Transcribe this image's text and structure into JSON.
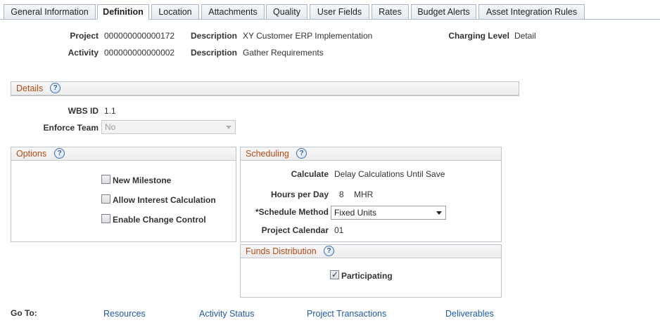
{
  "tabs": [
    {
      "label": "General Information"
    },
    {
      "label": "Definition",
      "active": true
    },
    {
      "label": "Location"
    },
    {
      "label": "Attachments"
    },
    {
      "label": "Quality"
    },
    {
      "label": "User Fields"
    },
    {
      "label": "Rates"
    },
    {
      "label": "Budget Alerts"
    },
    {
      "label": "Asset Integration Rules"
    }
  ],
  "header": {
    "project_label": "Project",
    "project_value": "000000000000172",
    "project_desc_label": "Description",
    "project_desc_value": "XY Customer ERP Implementation",
    "activity_label": "Activity",
    "activity_value": "000000000000002",
    "activity_desc_label": "Description",
    "activity_desc_value": "Gather Requirements",
    "charging_level_label": "Charging Level",
    "charging_level_value": "Detail"
  },
  "details": {
    "title": "Details",
    "wbs_label": "WBS ID",
    "wbs_value": "1.1",
    "enforce_team_label": "Enforce Team",
    "enforce_team_value": "No"
  },
  "options": {
    "title": "Options",
    "new_milestone": {
      "label": "New Milestone",
      "checked": false
    },
    "allow_interest": {
      "label": "Allow Interest Calculation",
      "checked": false
    },
    "enable_change": {
      "label": "Enable Change Control",
      "checked": false
    }
  },
  "scheduling": {
    "title": "Scheduling",
    "calculate_label": "Calculate",
    "calculate_value": "Delay Calculations Until Save",
    "hours_label": "Hours per Day",
    "hours_value": "8",
    "hours_unit": "MHR",
    "method_label": "*Schedule Method",
    "method_value": "Fixed Units",
    "calendar_label": "Project Calendar",
    "calendar_value": "01"
  },
  "funds": {
    "title": "Funds Distribution",
    "participating": {
      "label": "Participating",
      "checked": true
    }
  },
  "goto": {
    "label": "Go To:",
    "links": [
      "Resources",
      "Activity Status",
      "Project Transactions",
      "Deliverables"
    ]
  },
  "icons": {
    "help": "?",
    "check": "✓"
  }
}
